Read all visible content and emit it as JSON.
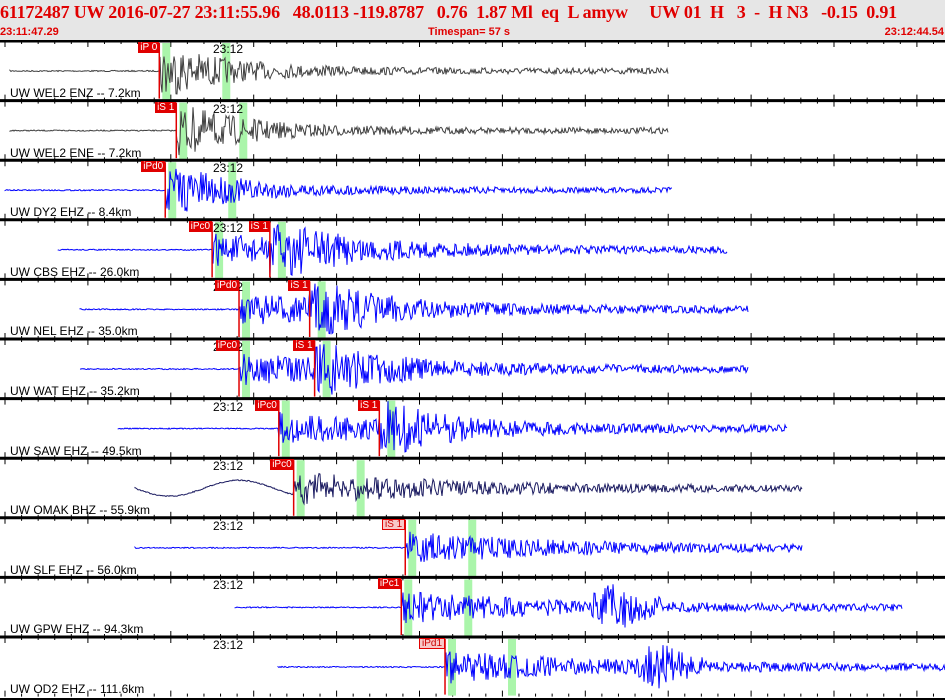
{
  "header": {
    "title": "61172487 UW 2016-07-27 23:11:55.96   48.0113 -119.8787   0.76  1.87 Ml  eq  L amyw     UW 01  H   3  -  H N3   -0.15  0.91",
    "start_time": "23:11:47.29",
    "timespan": "Timespan=  57 s",
    "end_time": "23:12:44.54"
  },
  "tick_label": "23:12",
  "colors": {
    "pick": "#e00000",
    "window": "#aaf5aa",
    "trace_blue": "#0000ff",
    "trace_gray": "#404040",
    "trace_navy": "#1a1a60"
  },
  "stations": [
    {
      "label": "UW WEL2 ENZ -- 7.2km",
      "color": "#404040",
      "picks": [
        {
          "label": "iP 0",
          "time": "23:11:56.94"
        }
      ]
    },
    {
      "label": "UW WEL2 ENE -- 7.2km",
      "color": "#404040",
      "picks": [
        {
          "label": "iS 1",
          "time": "23:11:57.97"
        }
      ]
    },
    {
      "label": "UW DY2 EHZ -- 8.4km",
      "color": "#0000ff",
      "picks": [
        {
          "label": "iPd0",
          "time": "23:11:57.30"
        }
      ]
    },
    {
      "label": "UW CBS EHZ -- 26.0km",
      "color": "#0000ff",
      "picks": [
        {
          "label": "iPc0",
          "time": "23:12:00.14"
        },
        {
          "label": "iS 1",
          "time": "23:12:03.64"
        }
      ]
    },
    {
      "label": "UW NEL EHZ -- 35.0km",
      "color": "#0000ff",
      "picks": [
        {
          "label": "iPd0",
          "time": "23:12:01.77"
        },
        {
          "label": "iS 1",
          "time": "23:12:06.05"
        }
      ]
    },
    {
      "label": "UW WAT EHZ -- 35.2km",
      "color": "#0000ff",
      "picks": [
        {
          "label": "iPc0",
          "time": "23:12:01.77"
        },
        {
          "label": "iS 1",
          "time": "23:12:06.35"
        }
      ]
    },
    {
      "label": "UW SAW EHZ -- 49.5km",
      "color": "#0000ff",
      "picks": [
        {
          "label": "iPc0",
          "time": "23:12:04.18"
        },
        {
          "label": "iS 1",
          "time": "23:12:10.27"
        }
      ]
    },
    {
      "label": "UW OMAK BHZ -- 55.9km",
      "color": "#1a1a60",
      "picks": [
        {
          "label": "iPc0",
          "time": "23:12:05.08"
        }
      ]
    },
    {
      "label": "UW SLF EHZ -- 56.0km",
      "color": "#0000ff",
      "picks": [
        {
          "label": "iS 1",
          "time": "23:12:11.84",
          "pale": true
        }
      ]
    },
    {
      "label": "UW GPW EHZ -- 94.3km",
      "color": "#0000ff",
      "picks": [
        {
          "label": "iPc1",
          "time": "23:12:11.60"
        }
      ]
    },
    {
      "label": "UW OD2 EHZ -- 111.6km",
      "color": "#0000ff",
      "picks": [
        {
          "label": "iPd1",
          "time": "23:12:14.25",
          "pale": true
        }
      ]
    }
  ]
}
